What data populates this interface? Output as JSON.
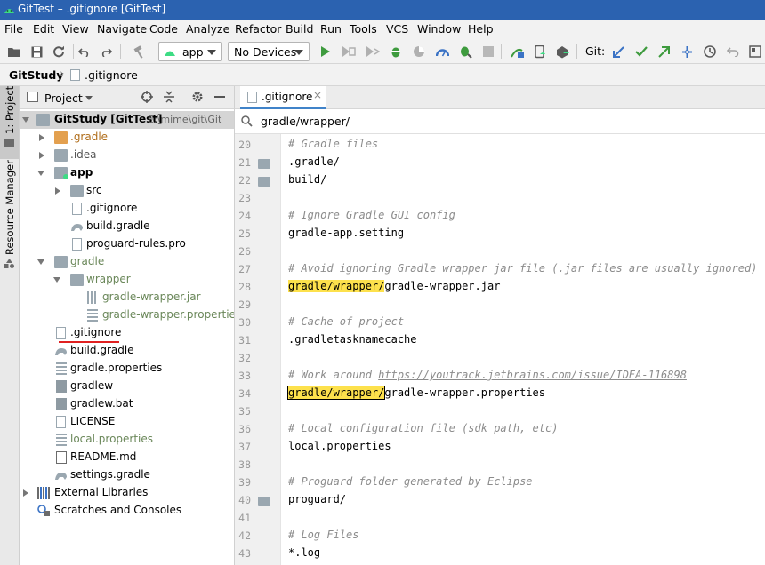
{
  "window": {
    "title": "GitTest – .gitignore [GitTest]"
  },
  "menu": [
    "File",
    "Edit",
    "View",
    "Navigate",
    "Code",
    "Analyze",
    "Refactor",
    "Build",
    "Run",
    "Tools",
    "VCS",
    "Window",
    "Help"
  ],
  "toolbar": {
    "run_config": "app",
    "device": "No Devices",
    "git_label": "Git:"
  },
  "breadcrumb": {
    "project": "GitStudy",
    "file": ".gitignore"
  },
  "sidebar_stripe": {
    "project_tab": "1: Project",
    "resource_tab": "Resource Manager"
  },
  "project_panel": {
    "header": "Project",
    "root_name": "GitStudy [GitTest]",
    "root_path": "E:\\mime\\git\\Git",
    "items": [
      {
        "label": ".gradle"
      },
      {
        "label": ".idea"
      },
      {
        "label": "app"
      },
      {
        "label": "src"
      },
      {
        "label": ".gitignore"
      },
      {
        "label": "build.gradle"
      },
      {
        "label": "proguard-rules.pro"
      },
      {
        "label": "gradle"
      },
      {
        "label": "wrapper"
      },
      {
        "label": "gradle-wrapper.jar"
      },
      {
        "label": "gradle-wrapper.properties"
      },
      {
        "label": ".gitignore"
      },
      {
        "label": "build.gradle"
      },
      {
        "label": "gradle.properties"
      },
      {
        "label": "gradlew"
      },
      {
        "label": "gradlew.bat"
      },
      {
        "label": "LICENSE"
      },
      {
        "label": "local.properties"
      },
      {
        "label": "README.md"
      },
      {
        "label": "settings.gradle"
      },
      {
        "label": "External Libraries"
      },
      {
        "label": "Scratches and Consoles"
      }
    ]
  },
  "editor": {
    "tab_label": ".gitignore",
    "search_path": "gradle/wrapper/",
    "lines": [
      {
        "n": "20",
        "text": "# Gradle files"
      },
      {
        "n": "21",
        "text": ".gradle/"
      },
      {
        "n": "22",
        "text": "build/"
      },
      {
        "n": "23",
        "text": ""
      },
      {
        "n": "24",
        "text": "# Ignore Gradle GUI config"
      },
      {
        "n": "25",
        "text": "gradle-app.setting"
      },
      {
        "n": "26",
        "text": ""
      },
      {
        "n": "27",
        "text": "# Avoid ignoring Gradle wrapper jar file (.jar files are usually ignored)"
      },
      {
        "n": "28",
        "hl": "gradle/wrapper/",
        "rest": "gradle-wrapper.jar"
      },
      {
        "n": "29",
        "text": ""
      },
      {
        "n": "30",
        "text": "# Cache of project"
      },
      {
        "n": "31",
        "text": ".gradletasknamecache"
      },
      {
        "n": "32",
        "text": ""
      },
      {
        "n": "33",
        "pre": "# Work around ",
        "url": "https://youtrack.jetbrains.com/issue/IDEA-116898"
      },
      {
        "n": "34",
        "hl": "gradle/wrapper/",
        "rest": "gradle-wrapper.properties"
      },
      {
        "n": "35",
        "text": ""
      },
      {
        "n": "36",
        "text": "# Local configuration file (sdk path, etc)"
      },
      {
        "n": "37",
        "text": "local.properties"
      },
      {
        "n": "38",
        "text": ""
      },
      {
        "n": "39",
        "text": "# Proguard folder generated by Eclipse"
      },
      {
        "n": "40",
        "text": "proguard/"
      },
      {
        "n": "41",
        "text": ""
      },
      {
        "n": "42",
        "text": "# Log Files"
      },
      {
        "n": "43",
        "text": "*.log"
      }
    ]
  },
  "colors": {
    "accent": "#4083c9",
    "highlight": "#fde14c",
    "underline_mark": "#e02020"
  }
}
